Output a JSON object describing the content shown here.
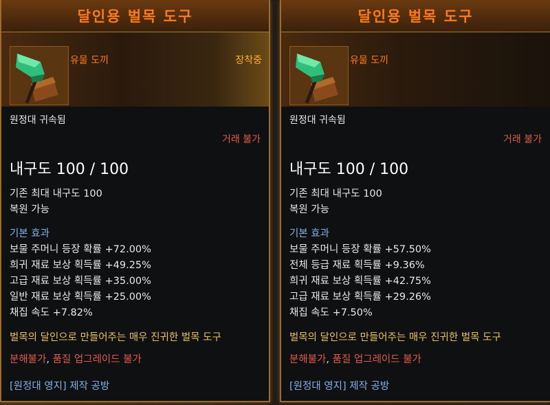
{
  "tooltips": [
    {
      "title": "달인용 벌목 도구",
      "grade": "유물 도끼",
      "equipped": "장착중",
      "bound": "원정대 귀속됨",
      "trade": "거래 불가",
      "durability": "내구도 100 / 100",
      "max_durability": "기존 최대 내구도 100",
      "restorable": "복원 가능",
      "base_effect_title": "기본 효과",
      "effects": [
        "보물 주머니 등장 확률 +72.00%",
        "희귀 재료 보상 획득률 +49.25%",
        "고급 재료 보상 획득률 +35.00%",
        "일반 재료 보상 획득률 +25.00%",
        "채집 속도 +7.82%"
      ],
      "description": "벌목의 달인으로 만들어주는 매우 진귀한 벌목 도구",
      "restrictions": {
        "part1": "분해불가",
        "sep": ",",
        "part2": "품질 업그레이드 불가"
      },
      "source": "[원정대 영지] 제작 공방"
    },
    {
      "title": "달인용 벌목 도구",
      "grade": "유물 도끼",
      "equipped": "",
      "bound": "원정대 귀속됨",
      "trade": "거래 불가",
      "durability": "내구도 100 / 100",
      "max_durability": "기존 최대 내구도 100",
      "restorable": "복원 가능",
      "base_effect_title": "기본 효과",
      "effects": [
        "보물 주머니 등장 확률 +57.50%",
        "전체 등급 재료 획득률 +9.36%",
        "희귀 재료 보상 획득률 +42.75%",
        "고급 재료 보상 획득률 +29.26%",
        "채집 속도 +7.50%"
      ],
      "description": "벌목의 달인으로 만들어주는 매우 진귀한 벌목 도구",
      "restrictions": {
        "part1": "분해불가",
        "sep": ",",
        "part2": "품질 업그레이드 불가"
      },
      "source": "[원정대 영지] 제작 공방"
    }
  ],
  "icons": {
    "item": "green-axe-icon"
  },
  "colors": {
    "title": "#ff7a1a",
    "equipped": "#ffb02e",
    "section": "#7fb3e8",
    "description": "#e8c264",
    "warning": "#e25a4a",
    "border": "#a06a28"
  }
}
